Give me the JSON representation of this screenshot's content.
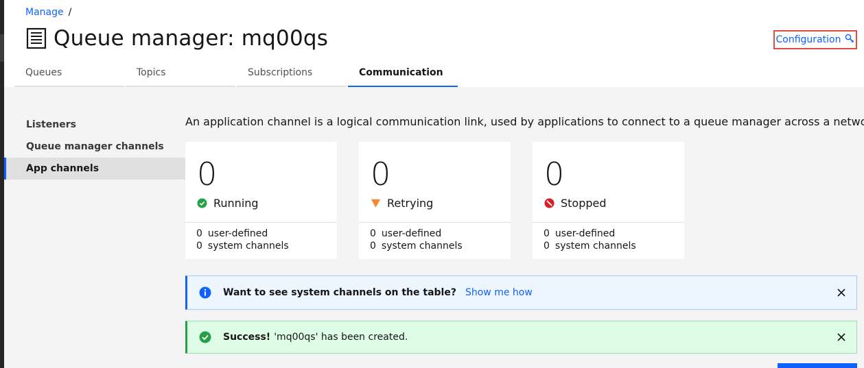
{
  "breadcrumb": {
    "manage": "Manage",
    "separator": "/"
  },
  "header": {
    "title": "Queue manager: mq00qs",
    "config_link": "Configuration",
    "icon": "document-icon",
    "config_icon": "wrench-icon"
  },
  "tabs": [
    {
      "label": "Queues",
      "active": false
    },
    {
      "label": "Topics",
      "active": false
    },
    {
      "label": "Subscriptions",
      "active": false
    },
    {
      "label": "Communication",
      "active": true
    }
  ],
  "sidenav": {
    "items": [
      {
        "label": "Listeners",
        "active": false
      },
      {
        "label": "Queue manager channels",
        "active": false
      },
      {
        "label": "App channels",
        "active": true
      }
    ]
  },
  "main": {
    "description": "An application channel is a logical communication link, used by applications to connect to a queue manager across a network.",
    "tiles": [
      {
        "count": "0",
        "status": "Running",
        "icon": "checkmark-filled-icon",
        "color": "#24a148",
        "user_count": "0",
        "user_label": "user-defined",
        "system_count": "0",
        "system_label": "system channels"
      },
      {
        "count": "0",
        "status": "Retrying",
        "icon": "warning-triangle-icon",
        "color": "#ff832b",
        "user_count": "0",
        "user_label": "user-defined",
        "system_count": "0",
        "system_label": "system channels"
      },
      {
        "count": "0",
        "status": "Stopped",
        "icon": "blocked-icon",
        "color": "#da1e28",
        "user_count": "0",
        "user_label": "user-defined",
        "system_count": "0",
        "system_label": "system channels"
      }
    ],
    "info_notification": {
      "title": "Want to see system channels on the table?",
      "link": "Show me how"
    },
    "success_notification": {
      "title": "Success!",
      "message": "'mq00qs' has been created."
    }
  },
  "colors": {
    "accent": "#0f62fe",
    "success": "#24a148",
    "warning": "#ff832b",
    "error": "#da1e28",
    "highlight_border": "#e34a3f"
  }
}
